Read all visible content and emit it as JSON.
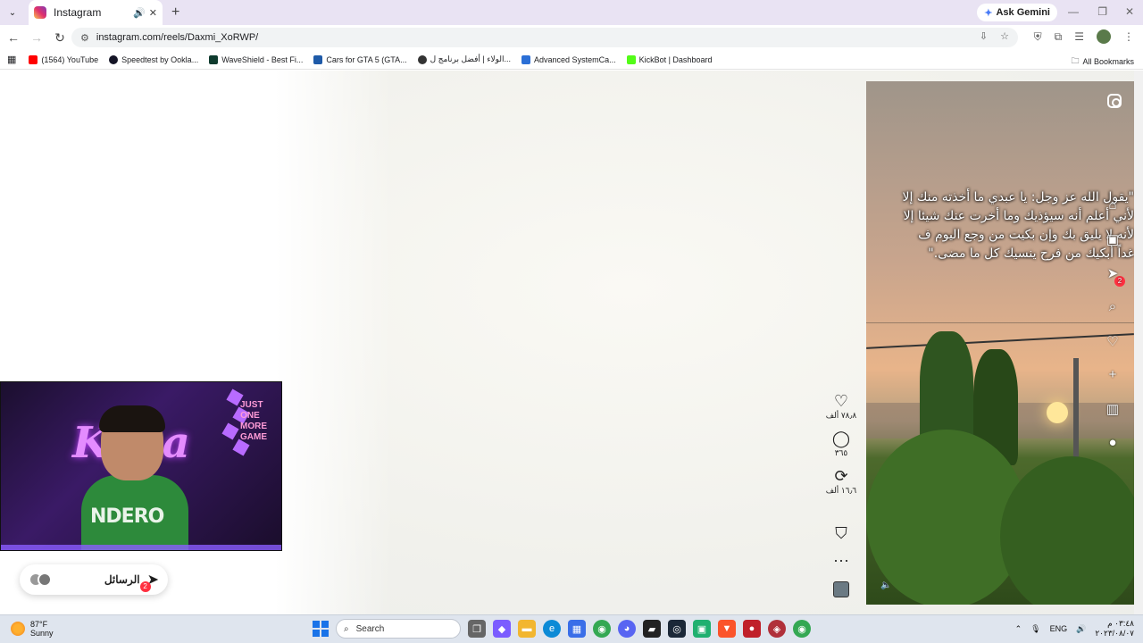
{
  "browser": {
    "tab": {
      "title": "Instagram"
    },
    "ask_gemini": "Ask Gemini",
    "url": "instagram.com/reels/Daxmi_XoRWP/",
    "bookmarks": [
      {
        "label": "(1564) YouTube",
        "color": "#ff0000"
      },
      {
        "label": "Speedtest by Ookla...",
        "color": "#141526"
      },
      {
        "label": "WaveShield - Best Fi...",
        "color": "#0f3b2e"
      },
      {
        "label": "Cars for GTA 5 (GTA...",
        "color": "#1e5aa8"
      },
      {
        "label": "الولاء | أفضل برنامج ل...",
        "color": "#333333"
      },
      {
        "label": "Advanced SystemCa...",
        "color": "#2b6fd6"
      },
      {
        "label": "KickBot | Dashboard",
        "color": "#53fc18"
      }
    ],
    "all_bookmarks": "All Bookmarks"
  },
  "reel": {
    "quote": "\"يقول الله عز وجل: يا عبدي ما أخذته منك إلا لأني أعلم أنه سيؤذيك وما أخرت عنك شيئا إلا لأنه لا يليق بك وإن بكيت من وجع اليوم ف غداً أبكيك من فرح ينسيك كل ما مضى.\"",
    "likes": "٧٨٫٨ ألف",
    "comments": "٣٦٥",
    "reposts": "١٦٫٦ ألف",
    "messages_badge": "2"
  },
  "messages": {
    "label": "الرسائل",
    "badge": "2"
  },
  "webcam": {
    "sign": "JUST ONE MORE GAME",
    "shirt": "NDERO",
    "neon": "Kyka"
  },
  "taskbar": {
    "weather_temp": "87°F",
    "weather_desc": "Sunny",
    "search_placeholder": "Search",
    "lang": "ENG",
    "time": "٠٣:٤٨ م",
    "date": "٢٠٢٣/٠٨/٠٧"
  }
}
